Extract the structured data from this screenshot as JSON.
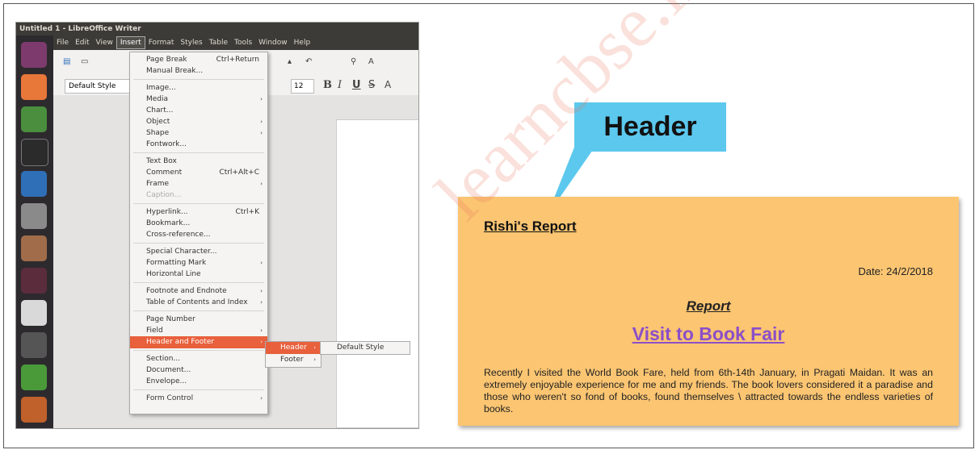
{
  "window": {
    "title": "Untitled 1 - LibreOffice Writer",
    "menu": [
      "File",
      "Edit",
      "View",
      "Insert",
      "Format",
      "Styles",
      "Table",
      "Tools",
      "Window",
      "Help"
    ],
    "active_menu": "Insert"
  },
  "formatting": {
    "paragraph_style": "Default Style",
    "font_size": "12"
  },
  "insert_menu": {
    "page_break": "Page Break",
    "page_break_shortcut": "Ctrl+Return",
    "manual_break": "Manual Break...",
    "image": "Image...",
    "media": "Media",
    "chart": "Chart...",
    "object": "Object",
    "shape": "Shape",
    "fontwork": "Fontwork...",
    "text_box": "Text Box",
    "comment": "Comment",
    "comment_shortcut": "Ctrl+Alt+C",
    "frame": "Frame",
    "caption": "Caption...",
    "hyperlink": "Hyperlink...",
    "hyperlink_shortcut": "Ctrl+K",
    "bookmark": "Bookmark...",
    "cross_reference": "Cross-reference...",
    "special_character": "Special Character...",
    "formatting_mark": "Formatting Mark",
    "horizontal_line": "Horizontal Line",
    "footnote": "Footnote and Endnote",
    "toc": "Table of Contents and Index",
    "page_number": "Page Number",
    "field": "Field",
    "header_footer": "Header and Footer",
    "section": "Section...",
    "document": "Document...",
    "envelope": "Envelope...",
    "form_control": "Form Control"
  },
  "submenu": {
    "header": "Header",
    "footer": "Footer",
    "default_style": "Default Style"
  },
  "callout": {
    "label": "Header",
    "color": "#5cc8ee"
  },
  "document": {
    "header_text": "Rishi's Report",
    "date": "Date: 24/2/2018",
    "report_heading": "Report",
    "title": "Visit to Book Fair",
    "body": "Recently I visited the World Book Fare, held from 6th-14th January, in Pragati Maidan. It was an extremely enjoyable experience for me and my friends. The book lovers considered it a paradise and those who weren't so fond of books, found themselves \\ attracted towards the endless varieties of books.",
    "page_color": "#fbc572",
    "title_color": "#8b4fc7"
  },
  "watermark": "learncbse.in"
}
